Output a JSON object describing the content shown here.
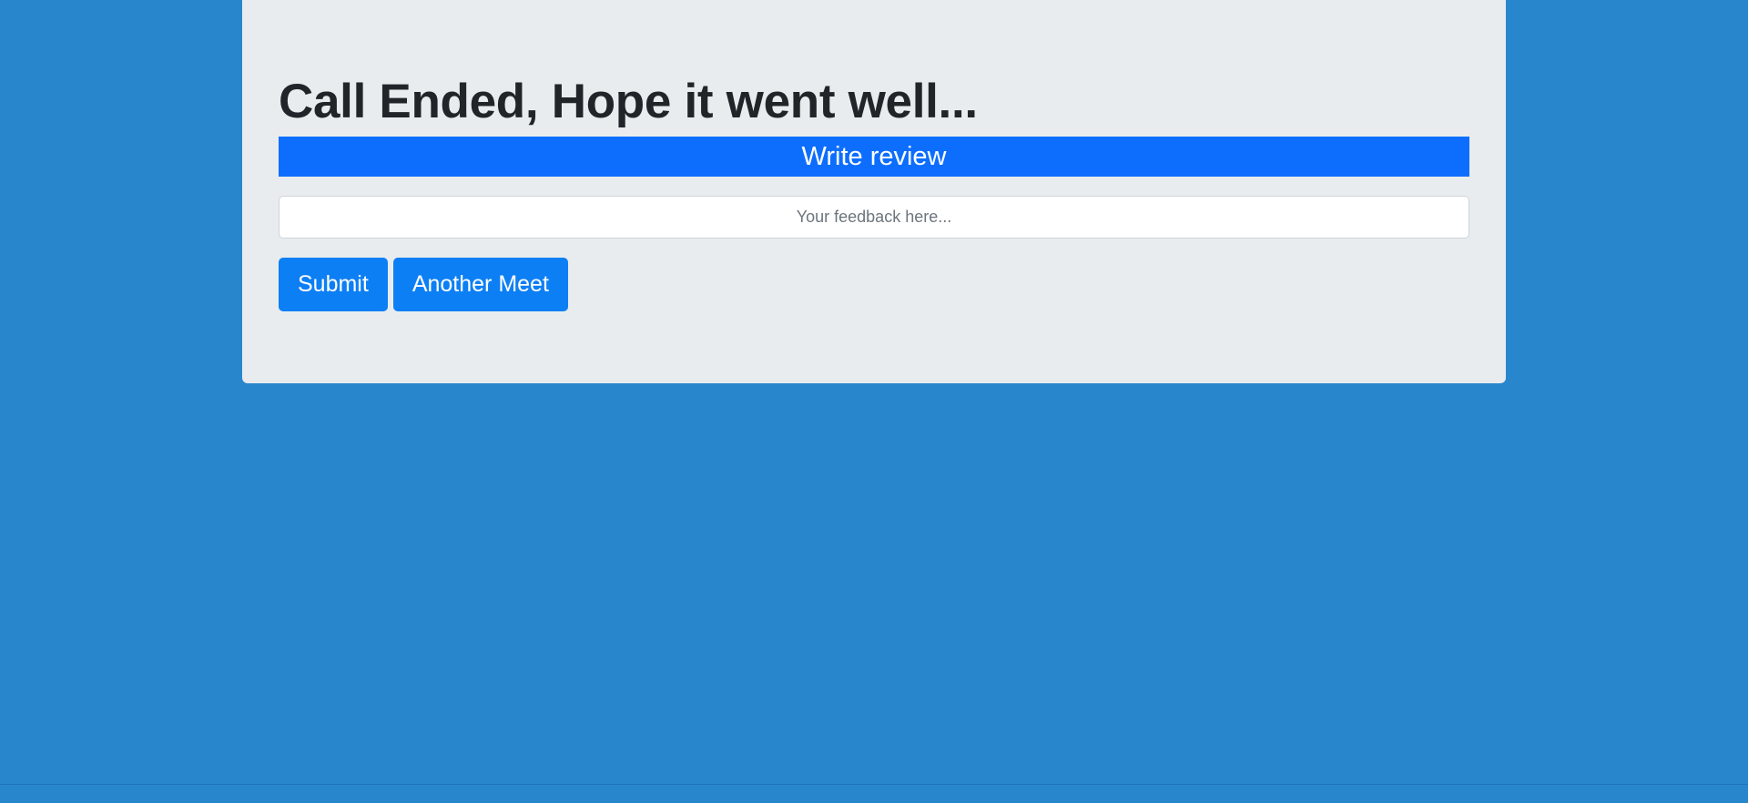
{
  "colors": {
    "page_background": "#2887cc",
    "card_background": "#e9ecef",
    "banner_background": "#0d6efd",
    "button_background": "#0d7ff5"
  },
  "header": {
    "title": "Call Ended, Hope it went well..."
  },
  "review": {
    "banner_label": "Write review",
    "feedback_value": "",
    "feedback_placeholder": "Your feedback here..."
  },
  "actions": {
    "submit_label": "Submit",
    "another_meet_label": "Another Meet"
  }
}
